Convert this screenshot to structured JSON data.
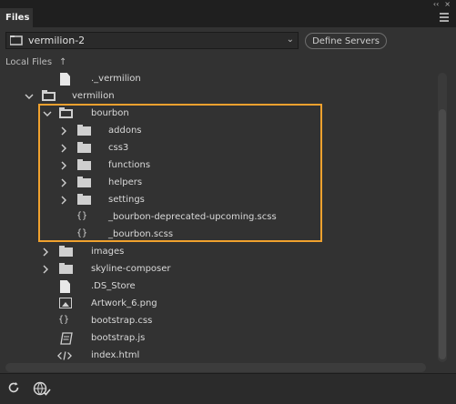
{
  "panel": {
    "tab_label": "Files",
    "collapse_glyph": "‹‹",
    "close_glyph": "×",
    "menu_icon": "hamburger-icon"
  },
  "site": {
    "name": "vermilion-2",
    "define_servers_label": "Define Servers"
  },
  "local": {
    "label": "Local Files"
  },
  "tree": {
    "rows": [
      {
        "label": "._vermilion",
        "icon": "file"
      },
      {
        "label": "vermilion",
        "icon": "folder-open"
      },
      {
        "label": "bourbon",
        "icon": "folder-open"
      },
      {
        "label": "addons",
        "icon": "folder"
      },
      {
        "label": "css3",
        "icon": "folder"
      },
      {
        "label": "functions",
        "icon": "folder"
      },
      {
        "label": "helpers",
        "icon": "folder"
      },
      {
        "label": "settings",
        "icon": "folder"
      },
      {
        "label": "_bourbon-deprecated-upcoming.scss",
        "icon": "code-braces"
      },
      {
        "label": "_bourbon.scss",
        "icon": "code-braces"
      },
      {
        "label": "images",
        "icon": "folder"
      },
      {
        "label": "skyline-composer",
        "icon": "folder"
      },
      {
        "label": ".DS_Store",
        "icon": "file"
      },
      {
        "label": "Artwork_6.png",
        "icon": "image"
      },
      {
        "label": "bootstrap.css",
        "icon": "code-braces"
      },
      {
        "label": "bootstrap.js",
        "icon": "script"
      },
      {
        "label": "index.html",
        "icon": "html"
      }
    ]
  },
  "bottom": {
    "refresh_icon": "refresh-icon",
    "globe_icon": "globe-check-icon"
  },
  "colors": {
    "highlight": "#f0a12e",
    "background": "#323232"
  }
}
